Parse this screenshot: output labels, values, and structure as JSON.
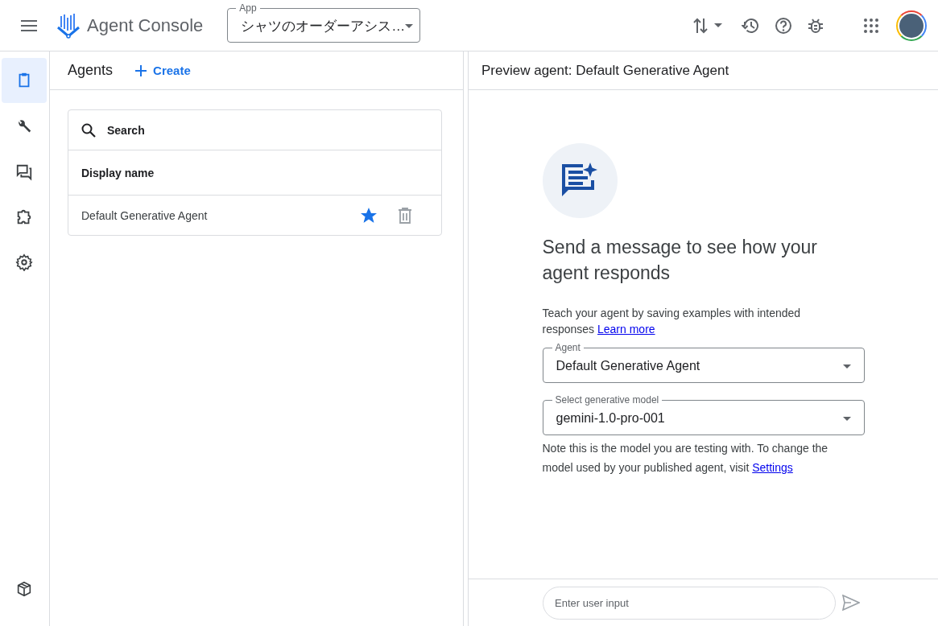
{
  "header": {
    "app_title": "Agent Console",
    "app_select": {
      "label": "App",
      "value": "シャツのオーダーアシス…"
    }
  },
  "nav_rail": {
    "items": [
      {
        "kind": "clipboard",
        "selected": true
      },
      {
        "kind": "wrench",
        "selected": false
      },
      {
        "kind": "chat",
        "selected": false
      },
      {
        "kind": "puzzle",
        "selected": false
      },
      {
        "kind": "gear",
        "selected": false
      }
    ],
    "bottom_item": {
      "kind": "cube",
      "selected": false
    }
  },
  "agents_panel": {
    "title": "Agents",
    "create_button": "Create",
    "search": {
      "placeholder": "Search"
    },
    "columns": [
      "Display name"
    ],
    "rows": [
      {
        "name": "Default Generative Agent",
        "starred": true
      }
    ]
  },
  "preview_panel": {
    "title": "Preview agent: Default Generative Agent",
    "heading": "Send a message to see how your agent responds",
    "description": "Teach your agent by saving examples with intended responses",
    "learn_more_link": "Learn more",
    "agent_select": {
      "label": "Agent",
      "value": "Default Generative Agent"
    },
    "model_select": {
      "label": "Select generative model",
      "value": "gemini-1.0-pro-001"
    },
    "note": "Note this is the model you are testing with. To change the model used by your published agent, visit",
    "settings_link": "Settings",
    "input": {
      "placeholder": "Enter user input"
    }
  }
}
